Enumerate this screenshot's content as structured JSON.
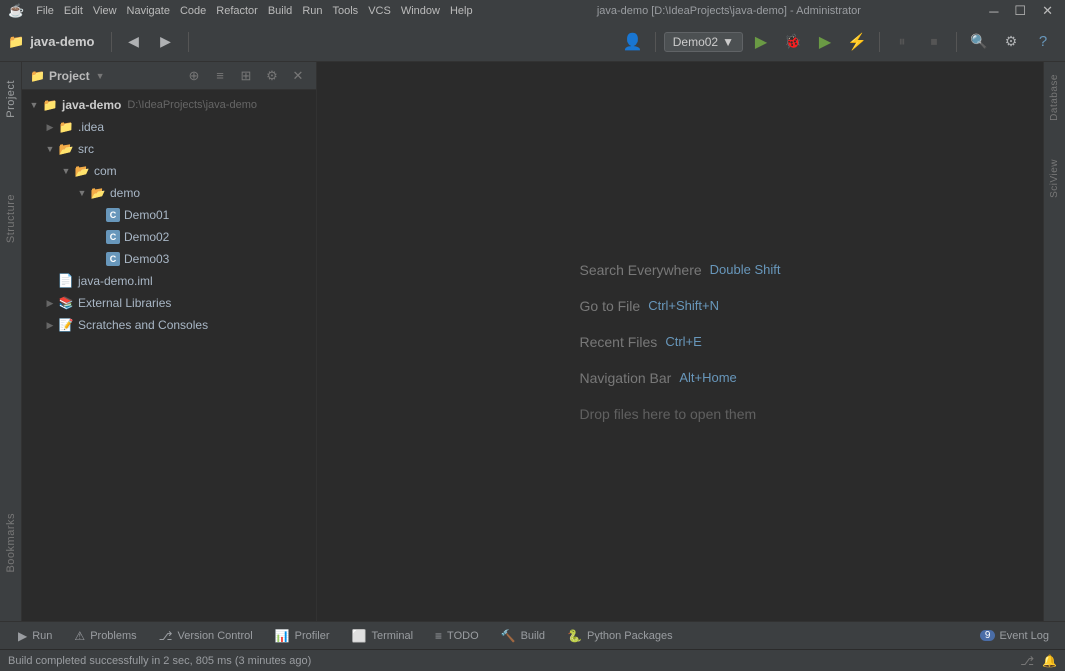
{
  "titlebar": {
    "app_icon": "☕",
    "project_name": "java-demo",
    "title": "java-demo [D:\\IdeaProjects\\java-demo] - Administrator",
    "menu_items": [
      "File",
      "Edit",
      "View",
      "Navigate",
      "Code",
      "Refactor",
      "Build",
      "Run",
      "Tools",
      "VCS",
      "Window",
      "Help"
    ],
    "win_minimize": "─",
    "win_restore": "☐",
    "win_close": "✕"
  },
  "toolbar": {
    "project_icon": "📁",
    "project_name": "java-demo",
    "run_config": "Demo02",
    "run_label": "▶",
    "debug_label": "🐞",
    "coverage_label": "▶",
    "search_icon": "🔍",
    "settings_icon": "⚙"
  },
  "project_panel": {
    "title": "Project",
    "root": {
      "name": "java-demo",
      "path": "D:\\IdeaProjects\\java-demo",
      "children": [
        {
          "name": ".idea",
          "type": "folder",
          "expanded": false
        },
        {
          "name": "src",
          "type": "folder",
          "expanded": true,
          "children": [
            {
              "name": "com",
              "type": "folder",
              "expanded": true,
              "children": [
                {
                  "name": "demo",
                  "type": "folder",
                  "expanded": true,
                  "children": [
                    {
                      "name": "Demo01",
                      "type": "class"
                    },
                    {
                      "name": "Demo02",
                      "type": "class"
                    },
                    {
                      "name": "Demo03",
                      "type": "class"
                    }
                  ]
                }
              ]
            }
          ]
        },
        {
          "name": "java-demo.iml",
          "type": "iml"
        },
        {
          "name": "External Libraries",
          "type": "libraries",
          "expanded": false
        },
        {
          "name": "Scratches and Consoles",
          "type": "scratch",
          "expanded": false
        }
      ]
    }
  },
  "editor": {
    "hints": [
      {
        "label": "Search Everywhere",
        "shortcut": "Double Shift",
        "type": "shortcut"
      },
      {
        "label": "Go to File",
        "shortcut": "Ctrl+Shift+N",
        "type": "shortcut"
      },
      {
        "label": "Recent Files",
        "shortcut": "Ctrl+E",
        "type": "shortcut"
      },
      {
        "label": "Navigation Bar",
        "shortcut": "Alt+Home",
        "type": "shortcut"
      },
      {
        "label": "Drop files here to open them",
        "shortcut": "",
        "type": "plain"
      }
    ]
  },
  "bottom_tabs": [
    {
      "icon": "▶",
      "label": "Run"
    },
    {
      "icon": "⚠",
      "label": "Problems"
    },
    {
      "icon": "⎇",
      "label": "Version Control"
    },
    {
      "icon": "📊",
      "label": "Profiler"
    },
    {
      "icon": "⬜",
      "label": "Terminal"
    },
    {
      "icon": "≡",
      "label": "TODO"
    },
    {
      "icon": "🔨",
      "label": "Build"
    },
    {
      "icon": "🐍",
      "label": "Python Packages"
    }
  ],
  "event_log": {
    "count": "9",
    "label": "Event Log"
  },
  "status_bar": {
    "message": "Build completed successfully in 2 sec, 805 ms (3 minutes ago)"
  },
  "right_tabs": [
    {
      "label": "Database"
    },
    {
      "label": "SciView"
    }
  ],
  "vertical_tabs": [
    {
      "label": "Project"
    },
    {
      "label": "Structure"
    },
    {
      "label": "Bookmarks"
    }
  ]
}
